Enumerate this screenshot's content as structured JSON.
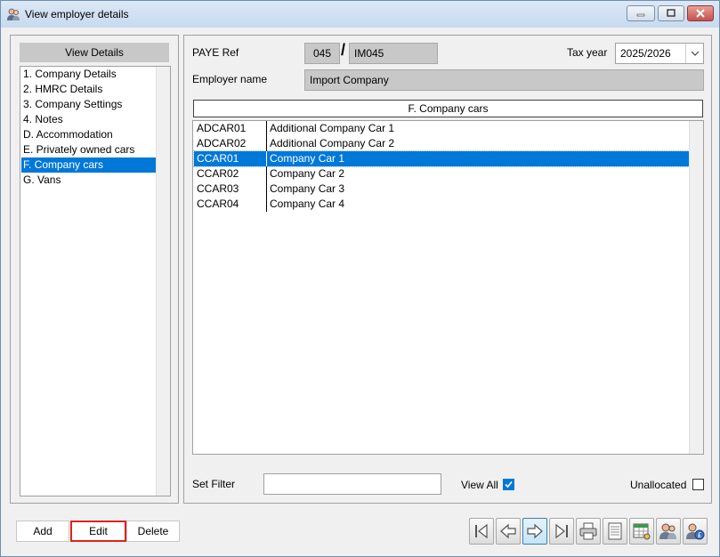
{
  "window": {
    "title": "View employer details"
  },
  "sidebar": {
    "header": "View Details",
    "items": [
      {
        "label": "1. Company Details"
      },
      {
        "label": "2. HMRC Details"
      },
      {
        "label": "3. Company Settings"
      },
      {
        "label": "4. Notes"
      },
      {
        "label": "D. Accommodation"
      },
      {
        "label": "E. Privately owned cars"
      },
      {
        "label": "F. Company cars",
        "selected": true
      },
      {
        "label": "G. Vans"
      }
    ]
  },
  "header": {
    "paye_label": "PAYE Ref",
    "paye_office": "045",
    "paye_ref": "IM045",
    "tax_year_label": "Tax year",
    "tax_year_value": "2025/2026",
    "employer_name_label": "Employer name",
    "employer_name_value": "Import Company"
  },
  "section": {
    "title": "F. Company cars"
  },
  "grid": {
    "rows": [
      {
        "code": "ADCAR01",
        "description": "Additional Company Car 1"
      },
      {
        "code": "ADCAR02",
        "description": "Additional Company Car 2"
      },
      {
        "code": "CCAR01",
        "description": "Company Car 1",
        "selected": true
      },
      {
        "code": "CCAR02",
        "description": "Company Car 2"
      },
      {
        "code": "CCAR03",
        "description": "Company Car 3"
      },
      {
        "code": "CCAR04",
        "description": "Company Car 4"
      }
    ]
  },
  "filters": {
    "set_filter_label": "Set Filter",
    "filter_value": "",
    "view_all_label": "View All",
    "view_all_checked": true,
    "unallocated_label": "Unallocated",
    "unallocated_checked": false
  },
  "actions": {
    "add_label": "Add",
    "edit_label": "Edit",
    "delete_label": "Delete"
  },
  "toolbar_icons": [
    "first-record-icon",
    "previous-record-icon",
    "next-record-icon",
    "last-record-icon",
    "print-icon",
    "report-icon",
    "spreadsheet-icon",
    "employees-icon",
    "employee-pay-icon"
  ],
  "colors": {
    "selection": "#0078d7",
    "readonly_field": "#c8c8c8",
    "focus_border": "#e02020"
  }
}
